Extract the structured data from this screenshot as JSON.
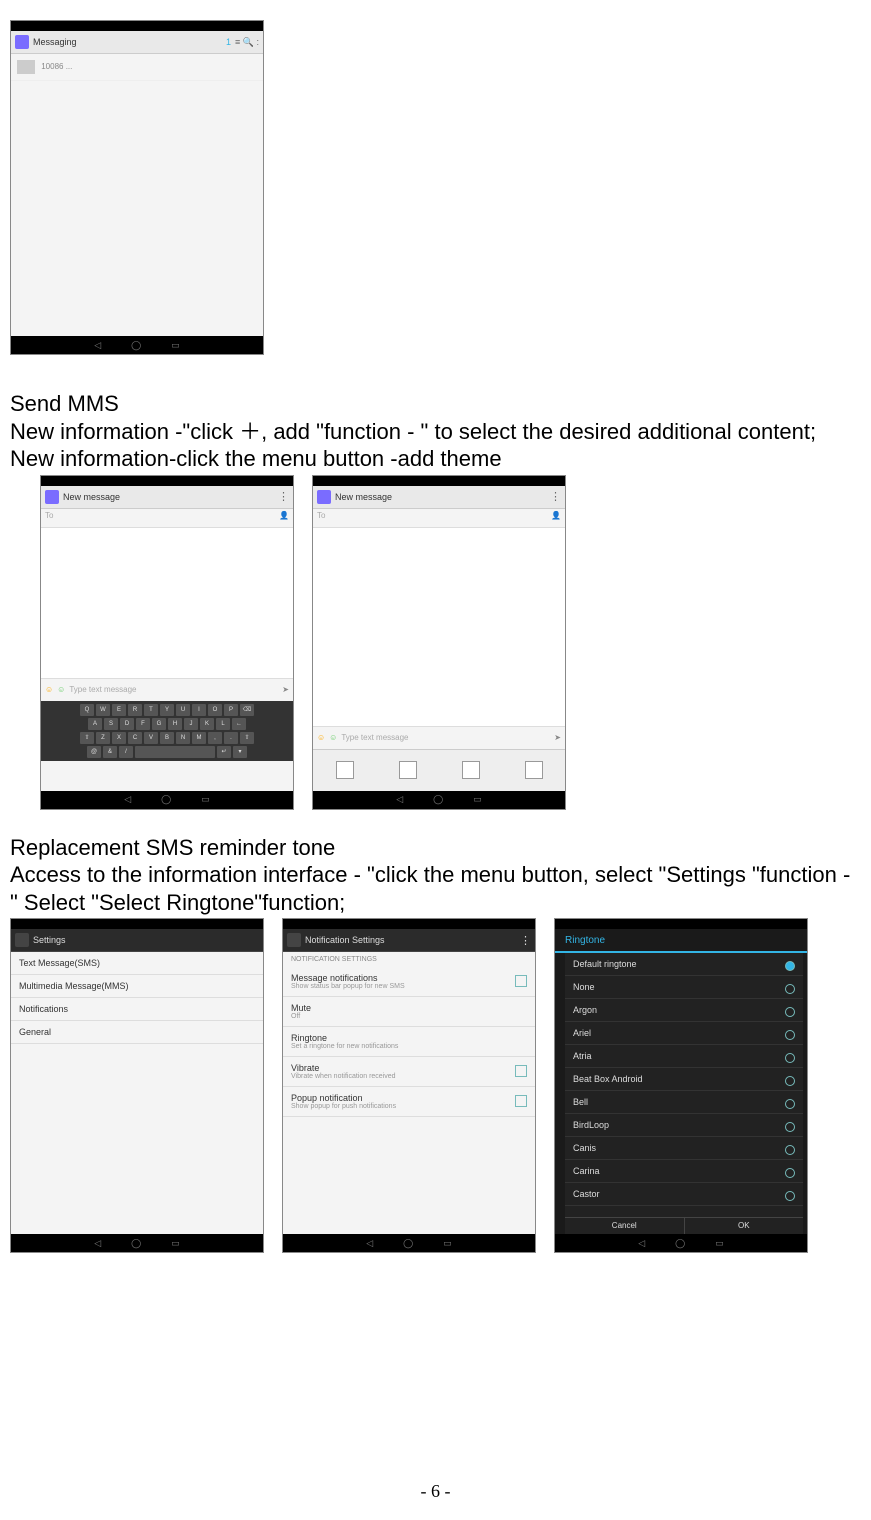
{
  "text": {
    "p1": "Send MMS",
    "p2": "New information -\"click ＋,    add \"function - \" to select the desired additional content;",
    "p3": "New information-click the menu button -add theme",
    "p4": "Replacement SMS reminder tone",
    "p5": "Access to the information interface - \"click the menu button, select \"Settings \"function - \" Select \"Select Ringtone\"function;"
  },
  "page_number": "- 6 -",
  "shots": {
    "messaging": {
      "title": "Messaging",
      "badge": "1",
      "status_icons": "≡  🔍  :"
    },
    "compose": {
      "title": "New message",
      "input_hint": "Type text message",
      "contact_icon": "👤"
    },
    "settings_list": {
      "title": "Settings",
      "items": [
        "Text Message(SMS)",
        "Multimedia Message(MMS)",
        "Notifications",
        "General"
      ]
    },
    "notif_settings": {
      "title": "Notification Settings",
      "section": "NOTIFICATION SETTINGS",
      "items": [
        {
          "t": "Message notifications",
          "s": "Show status bar popup for new SMS"
        },
        {
          "t": "Mute",
          "s": "Off"
        },
        {
          "t": "Ringtone",
          "s": "Set a ringtone for new notifications"
        },
        {
          "t": "Vibrate",
          "s": "Vibrate when notification received"
        },
        {
          "t": "Popup notification",
          "s": "Show popup for push notifications"
        }
      ]
    },
    "ringtone": {
      "title": "Ringtone",
      "items": [
        "Default ringtone",
        "None",
        "Argon",
        "Ariel",
        "Atria",
        "Beat Box Android",
        "Bell",
        "BirdLoop",
        "Canis",
        "Carina",
        "Castor"
      ],
      "buttons": [
        "Cancel",
        "OK"
      ]
    }
  }
}
